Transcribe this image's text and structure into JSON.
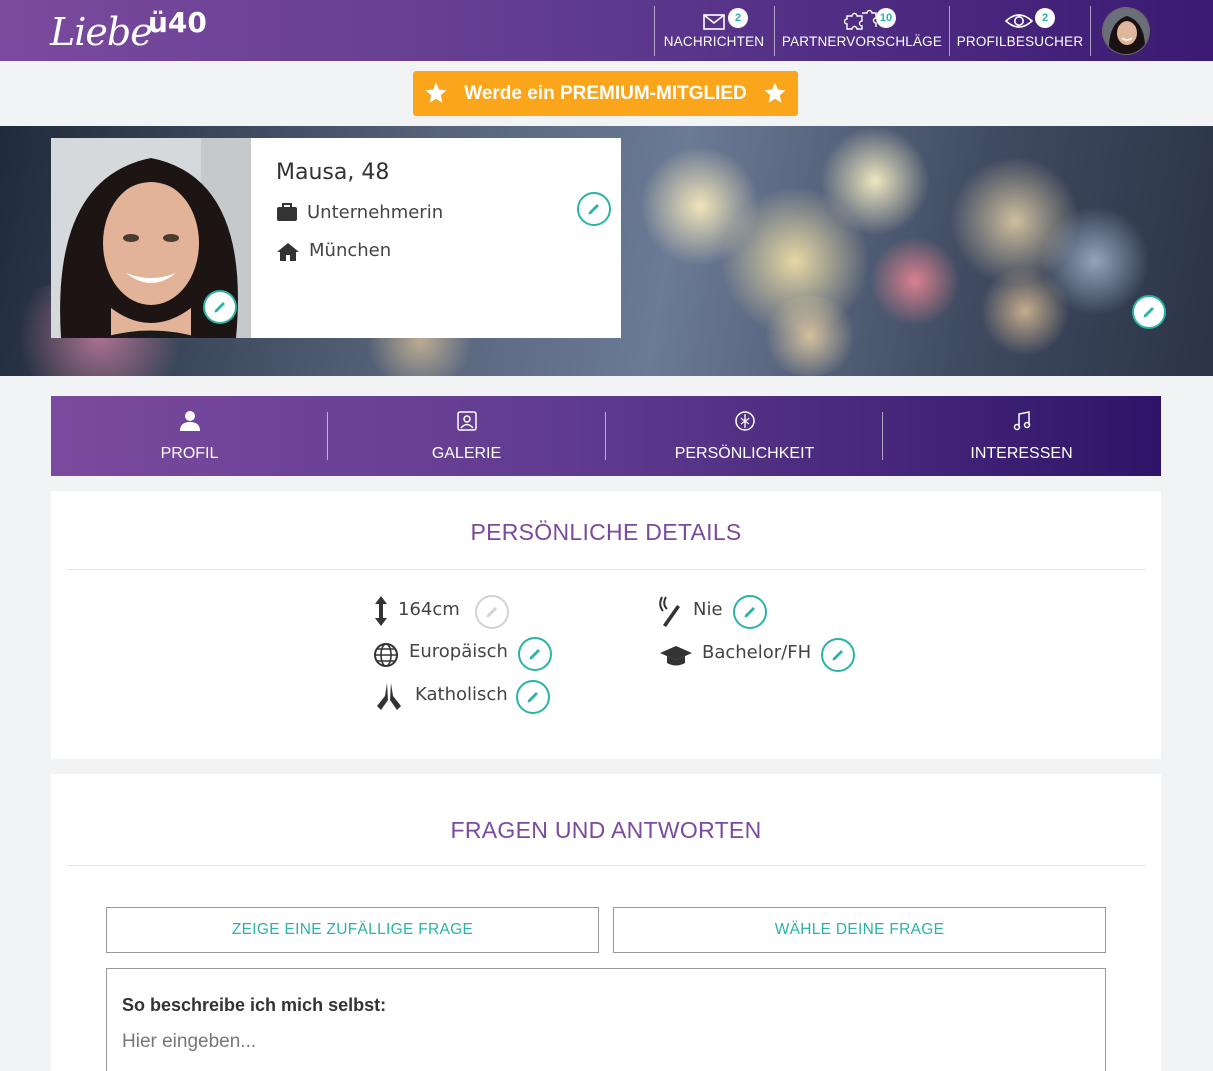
{
  "header": {
    "logo_script": "Liebe",
    "logo_suffix": "ü40",
    "nav": [
      {
        "label": "NACHRICHTEN",
        "badge": "2",
        "icon": "envelope-icon"
      },
      {
        "label": "PARTNERVORSCHLÄGE",
        "badge": "10",
        "icon": "puzzle-icon"
      },
      {
        "label": "PROFILBESUCHER",
        "badge": "2",
        "icon": "eye-icon"
      }
    ],
    "avatar_icon": "user-avatar"
  },
  "premium": {
    "label": "Werde ein PREMIUM-MITGLIED",
    "icon": "star-icon"
  },
  "profile": {
    "name": "Mausa, 48",
    "occupation": "Unternehmerin",
    "city": "München",
    "occupation_icon": "briefcase-icon",
    "city_icon": "home-icon",
    "edit_icon": "pencil-icon"
  },
  "tabs": [
    {
      "label": "PROFIL",
      "icon": "user-icon"
    },
    {
      "label": "GALERIE",
      "icon": "gallery-icon"
    },
    {
      "label": "PERSÖNLICHKEIT",
      "icon": "personality-icon"
    },
    {
      "label": "INTERESSEN",
      "icon": "music-icon"
    }
  ],
  "details": {
    "title": "PERSÖNLICHE DETAILS",
    "height": "164cm",
    "ethnicity": "Europäisch",
    "religion": "Katholisch",
    "smoking": "Nie",
    "education": "Bachelor/FH"
  },
  "qa": {
    "title": "FRAGEN UND ANTWORTEN",
    "random_button": "ZEIGE EINE ZUFÄLLIGE FRAGE",
    "choose_button": "WÄHLE DEINE FRAGE",
    "prompt": "So beschreibe ich mich selbst:",
    "placeholder": "Hier eingeben..."
  },
  "colors": {
    "primary": "#6a3d96",
    "accent": "#2ab3a6",
    "premium": "#fba51a"
  }
}
